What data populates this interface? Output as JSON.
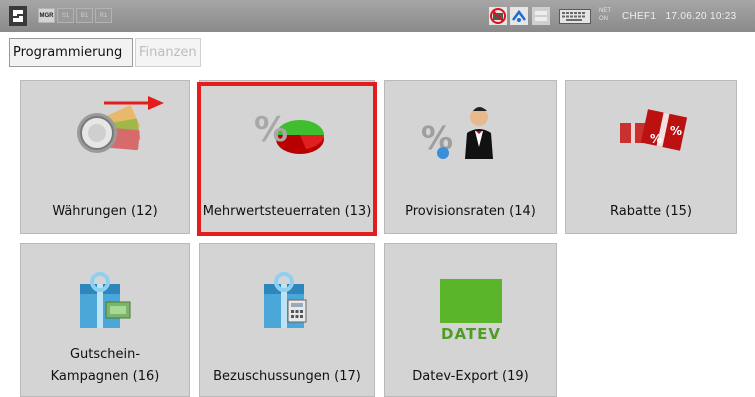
{
  "topbar": {
    "modes": [
      {
        "label": "MGR",
        "active": true
      },
      {
        "label": "S1",
        "active": false
      },
      {
        "label": "B1",
        "active": false
      },
      {
        "label": "R1",
        "active": false
      }
    ],
    "net_line1": "NET",
    "net_line2": "ON",
    "user": "CHEF1",
    "date": "17.06.20",
    "time": "10:23"
  },
  "tabs": [
    {
      "label": "Programmierung",
      "active": true
    },
    {
      "label": "Finanzen",
      "active": false
    }
  ],
  "tiles": [
    {
      "label": "Währungen (12)",
      "icon": "currency-coins-icon"
    },
    {
      "label": "Mehrwertsteuerraten (13)",
      "icon": "percent-pie-chart-icon",
      "highlighted": true
    },
    {
      "label": "Provisionsraten (14)",
      "icon": "percent-waiter-icon"
    },
    {
      "label": "Rabatte (15)",
      "icon": "gift-discount-icon"
    },
    {
      "label_line1": "Gutschein-",
      "label_line2": "Kampagnen (16)",
      "icon": "voucher-gift-icon"
    },
    {
      "label": "Bezuschussungen (17)",
      "icon": "gift-calculator-icon"
    },
    {
      "label": "Datev-Export (19)",
      "icon": "datev-logo-icon",
      "logo_text": "DATEV",
      "logo_color": "#5ab52a"
    }
  ],
  "colors": {
    "highlight": "#e31d1d",
    "tile_bg": "#d4d4d4",
    "topbar_bg": "#999999"
  }
}
